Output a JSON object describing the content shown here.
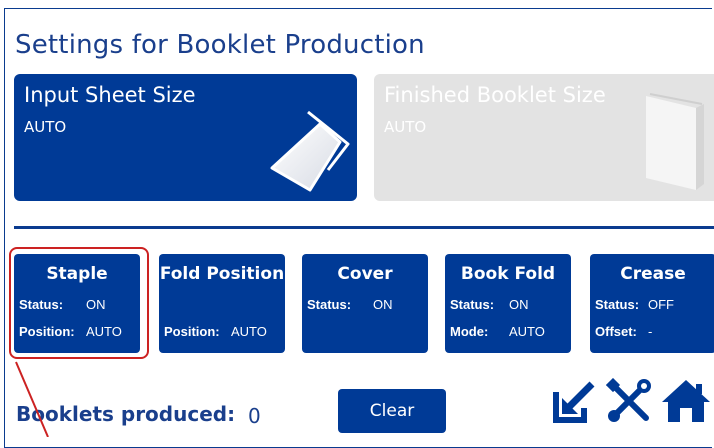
{
  "title": "Settings for Booklet Production",
  "input_sheet": {
    "label": "Input Sheet Size",
    "value": "AUTO"
  },
  "finished_booklet": {
    "label": "Finished Booklet Size",
    "value": "AUTO"
  },
  "tiles": {
    "staple": {
      "title": "Staple",
      "status_label": "Status:",
      "status_value": "ON",
      "position_label": "Position:",
      "position_value": "AUTO"
    },
    "fold_position": {
      "title": "Fold Position",
      "position_label": "Position:",
      "position_value": "AUTO"
    },
    "cover": {
      "title": "Cover",
      "status_label": "Status:",
      "status_value": "ON"
    },
    "book_fold": {
      "title": "Book Fold",
      "status_label": "Status:",
      "status_value": "ON",
      "mode_label": "Mode:",
      "mode_value": "AUTO"
    },
    "crease": {
      "title": "Crease",
      "status_label": "Status:",
      "status_value": "OFF",
      "offset_label": "Offset:",
      "offset_value": "-"
    }
  },
  "footer": {
    "produced_label": "Booklets produced:",
    "produced_count": "0",
    "clear_label": "Clear"
  },
  "icons": [
    "export-icon",
    "tools-icon",
    "home-icon"
  ],
  "colors": {
    "accent": "#003a96",
    "title": "#1a3f8c",
    "disabled": "#e3e3e3",
    "highlight": "#cc2222"
  }
}
